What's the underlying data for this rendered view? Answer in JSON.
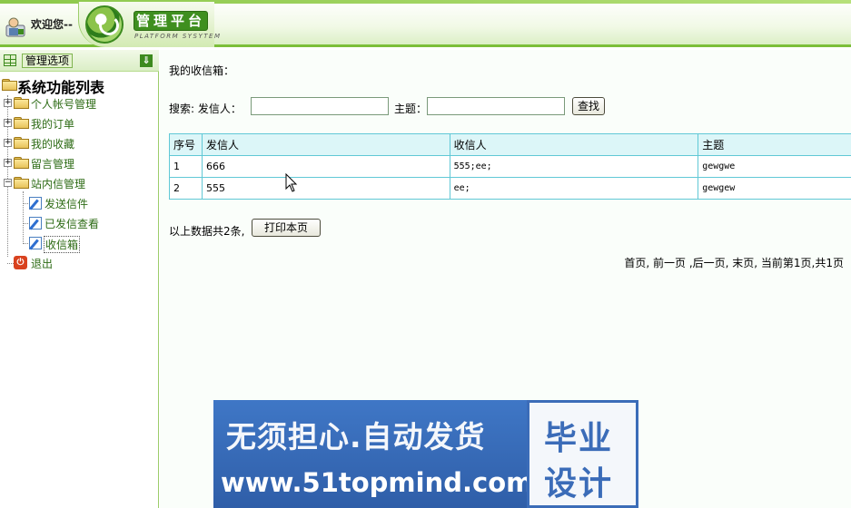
{
  "header": {
    "welcome": "欢迎您--",
    "brand_title": "管理平台",
    "brand_subtitle": "PLATFORM SYSYTEM"
  },
  "sidebar": {
    "manage_label": "管理选项",
    "tree_root": "系统功能列表",
    "items": [
      {
        "label": "个人帐号管理",
        "icon": "folder-icon",
        "expanded": false
      },
      {
        "label": "我的订单",
        "icon": "folder-icon",
        "expanded": false
      },
      {
        "label": "我的收藏",
        "icon": "folder-icon",
        "expanded": false
      },
      {
        "label": "留言管理",
        "icon": "folder-icon",
        "expanded": false
      },
      {
        "label": "站内信管理",
        "icon": "folder-icon",
        "expanded": true
      },
      {
        "label": "发送信件",
        "icon": "edit-icon"
      },
      {
        "label": "已发信查看",
        "icon": "edit-icon"
      },
      {
        "label": "收信箱",
        "icon": "edit-icon",
        "selected": true
      },
      {
        "label": "退出",
        "icon": "exit-icon"
      }
    ]
  },
  "main": {
    "title": "我的收信箱：",
    "search": {
      "label": "搜索: 发信人：",
      "sender_value": "",
      "subject_label": "主题：",
      "subject_value": "",
      "button": "查找"
    },
    "table": {
      "headers": [
        "序号",
        "发信人",
        "收信人",
        "主题"
      ],
      "rows": [
        [
          "1",
          "666",
          "555;ee;",
          "gewgwe"
        ],
        [
          "2",
          "555",
          "ee;",
          "gewgew"
        ]
      ]
    },
    "total_text": "以上数据共2条,",
    "print_button": "打印本页",
    "pager": "首页, 前一页 ,后一页, 末页, 当前第1页,共1页"
  },
  "watermark": {
    "line1": "无须担心.自动发货",
    "line2": "www.51topmind.com",
    "badge_line1": "毕业",
    "badge_line2": "设计"
  },
  "colors": {
    "accent_green": "#3f8f1f",
    "table_border": "#60c8d6",
    "table_header_bg": "#dcf6f8",
    "watermark_blue": "#3b6cb8"
  }
}
